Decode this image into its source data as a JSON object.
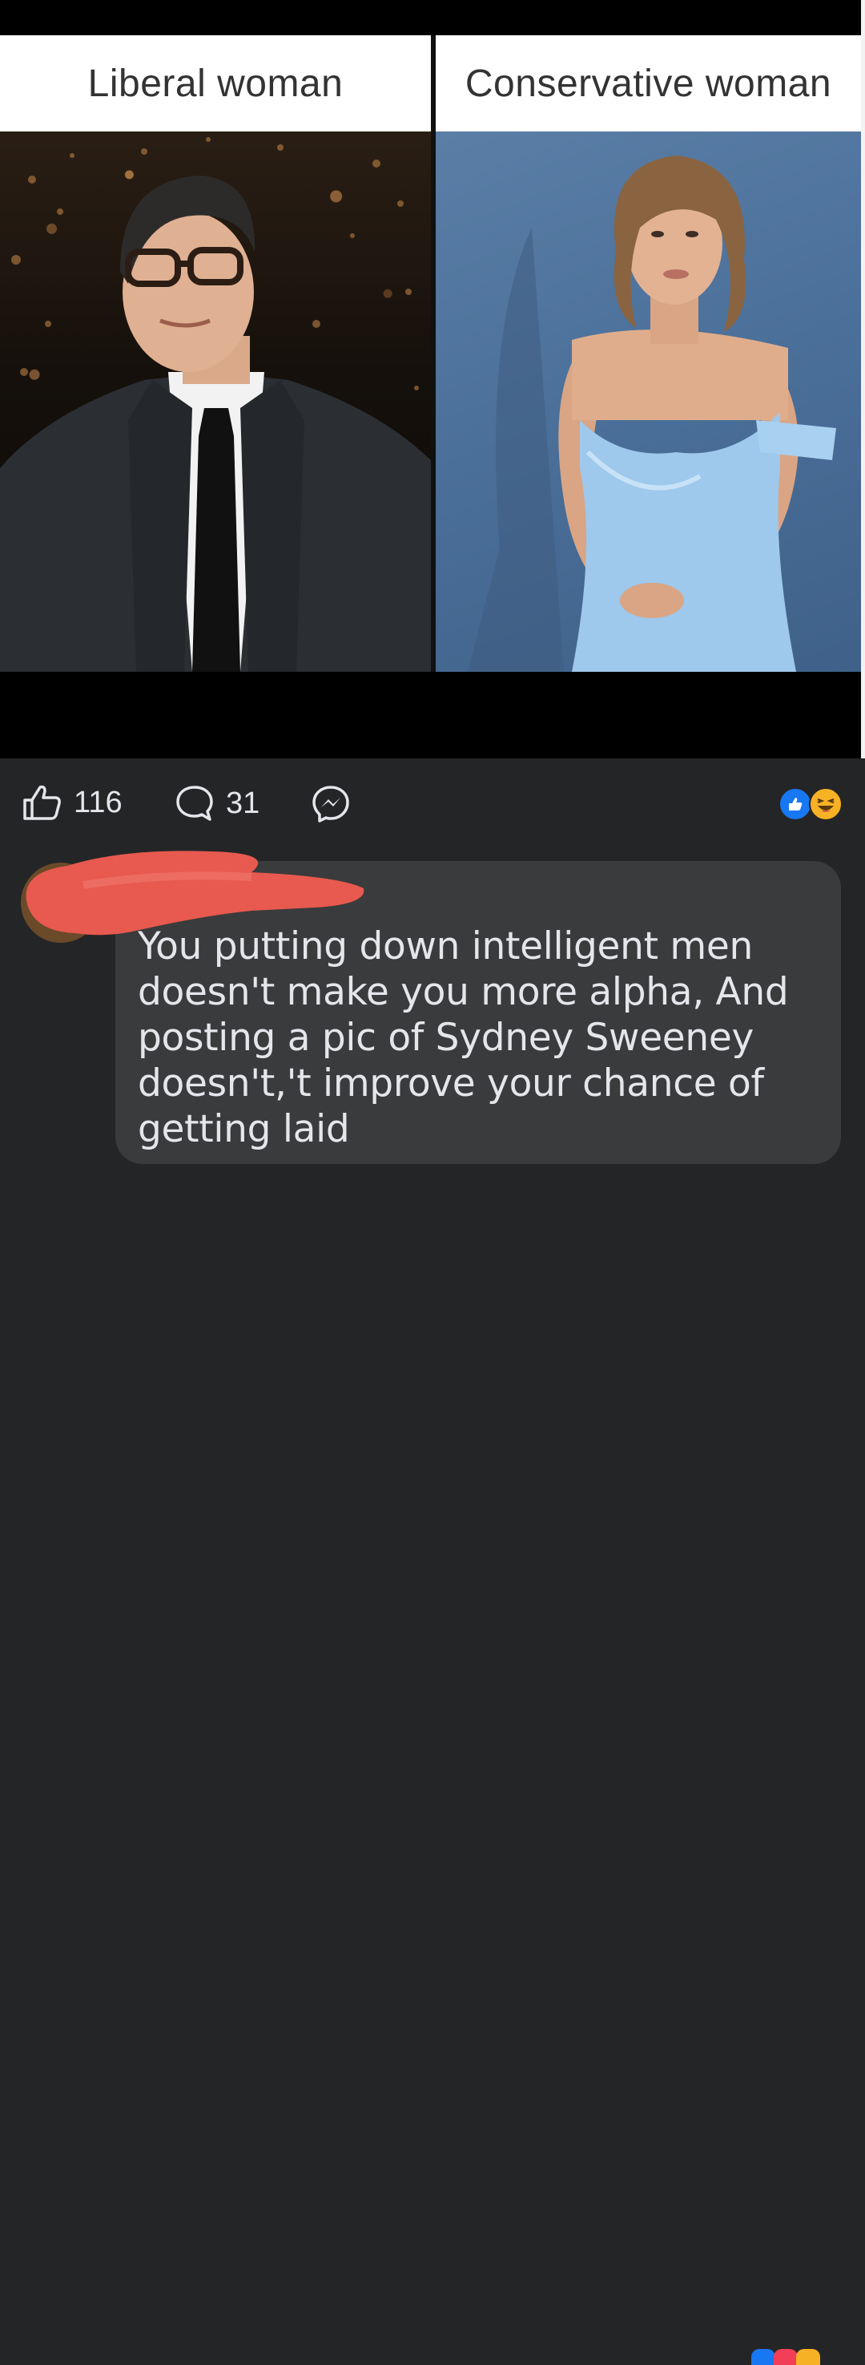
{
  "meme": {
    "left_label": "Liberal woman",
    "right_label": "Conservative woman"
  },
  "actions": {
    "like_count": "116",
    "comment_count": "31"
  },
  "reactions": [
    "like-icon",
    "haha-icon"
  ],
  "comment": {
    "text": "You putting down intelligent men doesn't make you more alpha, And posting a pic of Sydney Sweeney doesn't,'t improve your chance of getting laid"
  },
  "colors": {
    "background": "#242526",
    "bubble": "#3a3b3c",
    "text": "#e4e6eb",
    "redaction": "#e8594f",
    "like_blue": "#1877f2",
    "haha_yellow": "#f7b125"
  }
}
